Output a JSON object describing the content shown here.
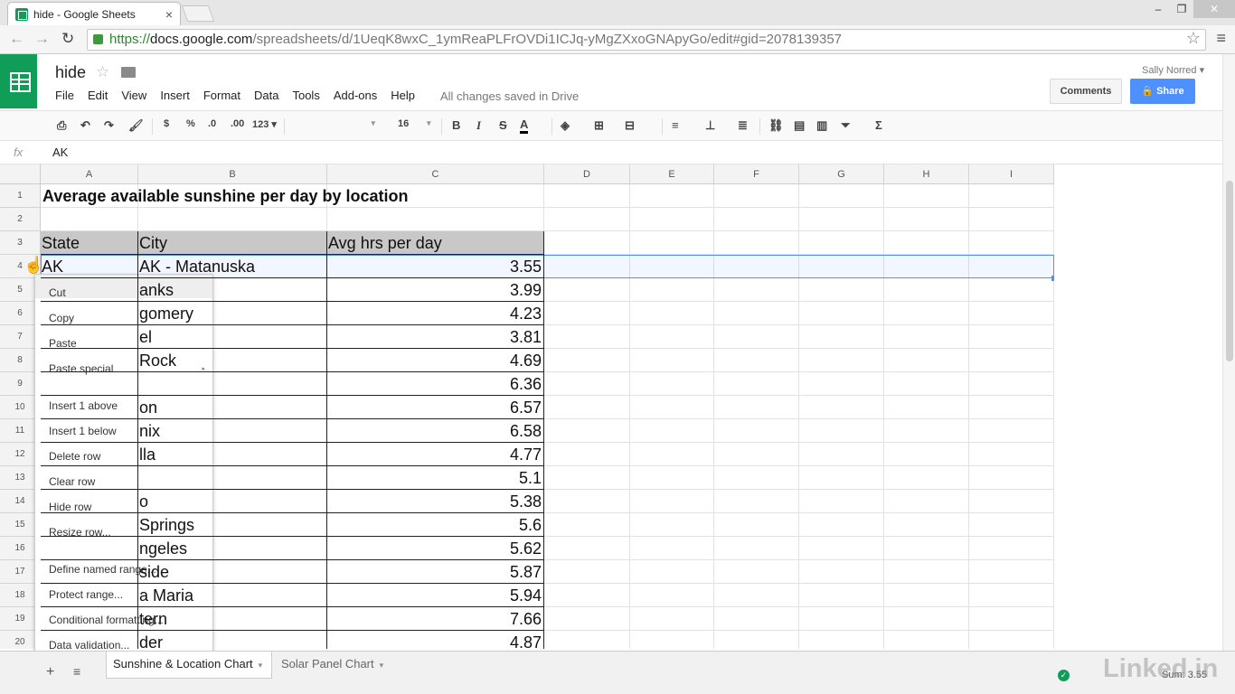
{
  "browser": {
    "tab_title": "hide - Google Sheets",
    "tab_close": "×",
    "url_https": "https://",
    "url_host": "docs.google.com",
    "url_path": "/spreadsheets/d/1UeqK8wxC_1ymReaPLFrOVDi1ICJq-yMgZXxoGNApyGo/edit#gid=2078139357",
    "back_icon": "←",
    "forward_icon": "→",
    "reload_icon": "↻",
    "bookmark_icon": "☆",
    "menu_icon": "≡",
    "win_minimize": "–",
    "win_restore": "❐",
    "win_close": "✕"
  },
  "doc": {
    "title": "hide",
    "star": "☆",
    "menus": [
      "File",
      "Edit",
      "View",
      "Insert",
      "Format",
      "Data",
      "Tools",
      "Add-ons",
      "Help"
    ],
    "saved_status": "All changes saved in Drive",
    "user": "Sally Norred ▾",
    "comments_label": "Comments",
    "share_label": "Share"
  },
  "toolbar": {
    "dollar": "$",
    "percent": "%",
    "dec_less": ".0",
    "dec_more": ".00",
    "num_format": "123 ▾",
    "font_size": "16",
    "bold": "B",
    "italic": "I",
    "strike": "S",
    "text_color": "A",
    "sum": "Σ"
  },
  "formula": {
    "fx": "fx",
    "value": "AK"
  },
  "columns": [
    "A",
    "B",
    "C",
    "D",
    "E",
    "F",
    "G",
    "H",
    "I"
  ],
  "rows": [
    "1",
    "2",
    "3",
    "4",
    "5",
    "6",
    "7",
    "8",
    "9",
    "10",
    "11",
    "12",
    "13",
    "14",
    "15",
    "16",
    "17",
    "18",
    "19",
    "20"
  ],
  "sheet": {
    "title": "Average available sunshine per day by location",
    "headers": [
      "State",
      "City",
      "Avg hrs per day"
    ],
    "row4": {
      "state": "AK",
      "city": "AK - Matanuska",
      "value": "3.55"
    },
    "visible_city_fragments": [
      "anks",
      "gomery",
      "el",
      " Rock",
      "",
      "on",
      "nix",
      "lla",
      "",
      "o",
      " Springs",
      "ngeles",
      "side",
      "a Maria",
      "tern",
      "der"
    ],
    "values": [
      "3.99",
      "4.23",
      "3.81",
      "4.69",
      "6.36",
      "6.57",
      "6.58",
      "4.77",
      "5.1",
      "5.38",
      "5.6",
      "5.62",
      "5.87",
      "5.94",
      "7.66",
      "4.87"
    ]
  },
  "context_menu": {
    "items": [
      {
        "label": "Cut"
      },
      {
        "label": "Copy"
      },
      {
        "label": "Paste"
      },
      {
        "label": "Paste special"
      },
      {
        "label": "Insert 1 above"
      },
      {
        "label": "Insert 1 below"
      },
      {
        "label": "Delete row"
      },
      {
        "label": "Clear row"
      },
      {
        "label": "Hide row"
      },
      {
        "label": "Resize row..."
      },
      {
        "label": "Define named range..."
      },
      {
        "label": "Protect range..."
      },
      {
        "label": "Conditional formatting..."
      },
      {
        "label": "Data validation..."
      }
    ],
    "submenu_arrow": "▸"
  },
  "bottom": {
    "add_sheet": "+",
    "all_sheets": "≡",
    "tabs": [
      "Sunshine & Location Chart",
      "Solar Panel Chart"
    ],
    "tab_caret": "▾",
    "status_check": "✓",
    "sum": "Sum: 3.55",
    "watermark": "Linked in"
  }
}
